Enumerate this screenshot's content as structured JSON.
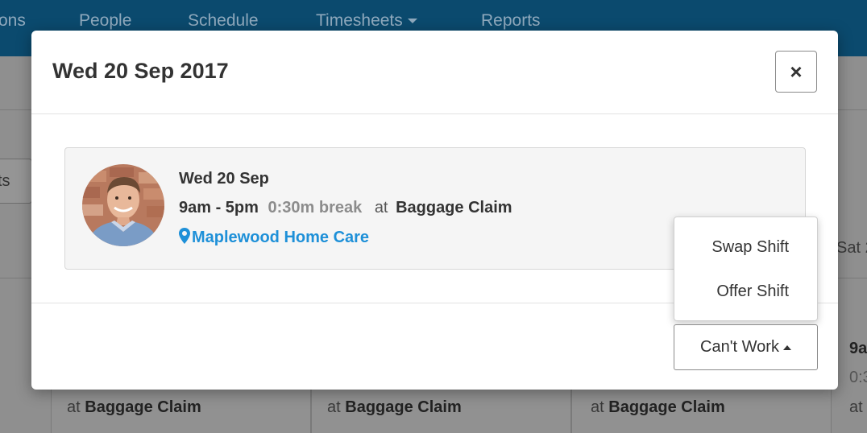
{
  "nav": {
    "items": [
      "ons",
      "People",
      "Schedule",
      "Timesheets",
      "Reports"
    ]
  },
  "background": {
    "button_label": "ts",
    "day_header": "Sat 2",
    "time_partial": "9a",
    "break_partial": "0:3",
    "at_partial": "at",
    "cards": [
      {
        "at": "at",
        "location": "Baggage Claim"
      },
      {
        "at": "at",
        "location": "Baggage Claim"
      },
      {
        "at": "at",
        "location": "Baggage Claim"
      }
    ]
  },
  "modal": {
    "title": "Wed 20 Sep 2017",
    "close_label": "×",
    "shift": {
      "date": "Wed 20 Sep",
      "hours": "9am - 5pm",
      "break": "0:30m break",
      "at": "at",
      "location": "Baggage Claim",
      "workplace": "Maplewood Home Care"
    },
    "cant_work_label": "Can't Work",
    "dropdown": [
      "Swap Shift",
      "Offer Shift"
    ]
  },
  "colors": {
    "nav_bg": "#0b4a6e",
    "link": "#1e90d8",
    "break_text": "#8c8c8c"
  },
  "icons": {
    "close": "close-icon",
    "location": "map-pin-icon",
    "caret": "caret-up-icon"
  }
}
